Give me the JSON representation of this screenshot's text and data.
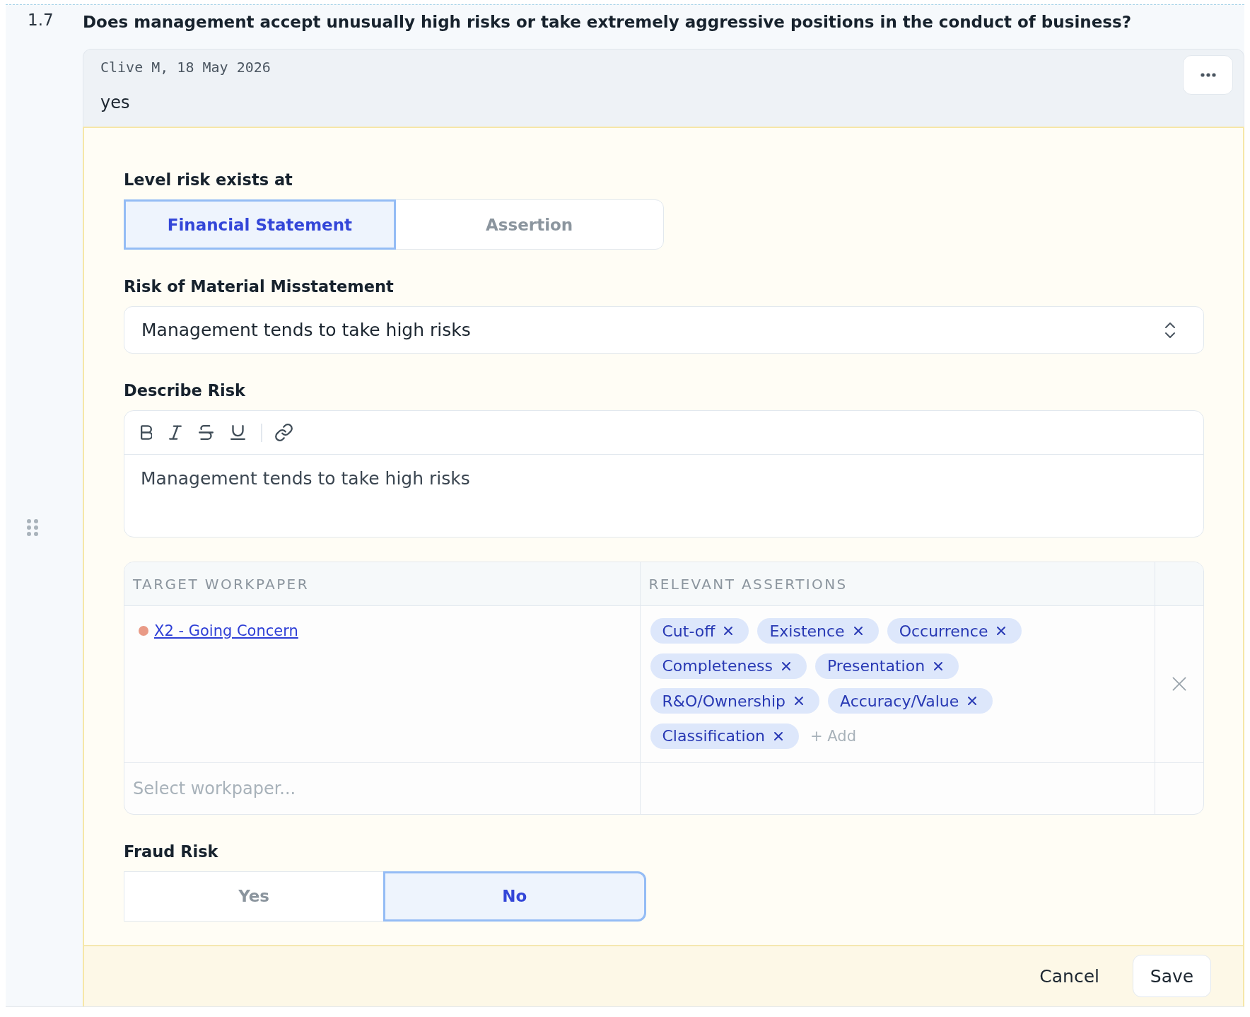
{
  "question": {
    "number": "1.7",
    "text": "Does management accept unusually high risks or take extremely aggressive positions in the conduct of business?"
  },
  "comment": {
    "meta": "Clive M, 18 May 2026",
    "text": "yes"
  },
  "form": {
    "level": {
      "label": "Level risk exists at",
      "options": [
        {
          "label": "Financial Statement",
          "selected": true
        },
        {
          "label": "Assertion",
          "selected": false
        }
      ]
    },
    "risk": {
      "label": "Risk of Material Misstatement",
      "value": "Management tends to take high risks"
    },
    "description": {
      "label": "Describe Risk",
      "value": "Management tends to take high risks"
    },
    "workpapers": {
      "columns": [
        "TARGET WORKPAPER",
        "RELEVANT ASSERTIONS"
      ],
      "rows": [
        {
          "workpaper": "X2 - Going Concern",
          "color": "#e99a86",
          "assertions": [
            "Cut-off",
            "Existence",
            "Occurrence",
            "Completeness",
            "Presentation",
            "R&O/Ownership",
            "Accuracy/Value",
            "Classification"
          ],
          "add": "+ Add"
        }
      ],
      "placeholder": "Select workpaper..."
    },
    "fraud": {
      "label": "Fraud Risk",
      "options": [
        {
          "label": "Yes",
          "selected": false
        },
        {
          "label": "No",
          "selected": true
        }
      ]
    }
  },
  "footer": {
    "buttons": [
      {
        "label": "Cancel",
        "kind": "text"
      },
      {
        "label": "Save",
        "kind": "outlined"
      }
    ]
  }
}
